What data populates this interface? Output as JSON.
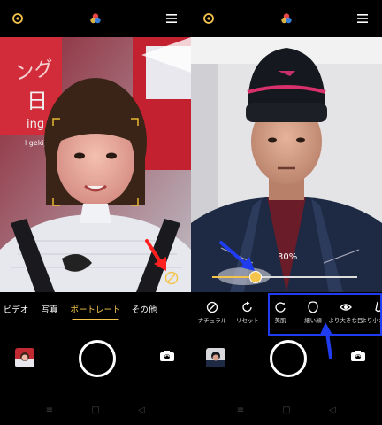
{
  "left_screen": {
    "modes": [
      "ビデオ",
      "写真",
      "ポートレート",
      "その他"
    ],
    "active_mode": "ポートレート",
    "signage_text": [
      "ング",
      "日",
      "ing",
      "l gekijo"
    ],
    "icons": {
      "top_left": "settings-ring-icon",
      "top_center": "color-filter-icon",
      "top_right": "menu-icon",
      "bokeh": "bokeh-aperture-icon",
      "flip": "flip-camera-icon"
    },
    "annotation_arrow_color": "#ff2020"
  },
  "right_screen": {
    "slider_value": "30%",
    "beauty_options": [
      {
        "label": "ナチュラル",
        "icon": "natural-off-icon"
      },
      {
        "label": "リセット",
        "icon": "reset-icon"
      },
      {
        "label": "美肌",
        "icon": "smooth-skin-icon"
      },
      {
        "label": "細い顔",
        "icon": "slim-face-icon"
      },
      {
        "label": "より大きな目",
        "icon": "bigger-eyes-icon"
      },
      {
        "label": "より小さな鼻",
        "icon": "nose-icon"
      }
    ],
    "annotation_color": "#1f3cf0"
  },
  "nav": [
    "≡",
    "□",
    "◁"
  ]
}
